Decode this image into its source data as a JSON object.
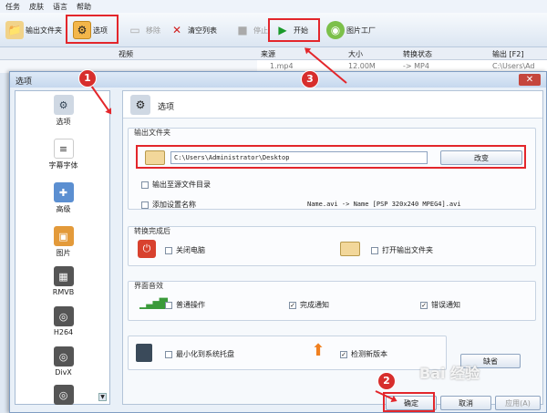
{
  "menu": [
    "任务",
    "皮肤",
    "语言",
    "帮助"
  ],
  "toolbar": {
    "output_folder": "输出文件夹",
    "options": "选项",
    "remove": "移除",
    "clear_list": "清空列表",
    "stop": "停止",
    "start": "开始",
    "factory": "图片工厂"
  },
  "left_header": "视频",
  "list_headers": [
    "来源",
    "大小",
    "转换状态",
    "输出 [F2]"
  ],
  "list_row": [
    "1.mp4",
    "12.00M",
    "-> MP4",
    "C:\\Users\\Ad"
  ],
  "dialog": {
    "title": "选项",
    "panel_title": "选项",
    "sidebar": [
      "选项",
      "字幕字体",
      "高级",
      "图片",
      "RMVB",
      "H264",
      "DivX"
    ],
    "output": {
      "title": "输出文件夹",
      "path": "C:\\Users\\Administrator\\Desktop",
      "change_button": "改变",
      "to_source_folder": "输出至源文件目录",
      "add_setting_name": "添加设置名称",
      "name_example": "Name.avi  -> Name [PSP 320x240 MPEG4].avi"
    },
    "after": {
      "title": "转换完成后",
      "shutdown": "关闭电脑",
      "open_folder": "打开输出文件夹"
    },
    "sound": {
      "title": "界面音效",
      "normal": "普通操作",
      "complete": "完成通知",
      "error": "错误通知"
    },
    "misc": {
      "minimize_tray": "最小化到系统托盘",
      "check_update": "检测新版本",
      "default_button": "缺省"
    },
    "buttons": {
      "ok": "确定",
      "cancel": "取消",
      "apply": "应用(A)"
    }
  },
  "markers": [
    "1",
    "2",
    "3"
  ],
  "watermark": "Bai 经验"
}
